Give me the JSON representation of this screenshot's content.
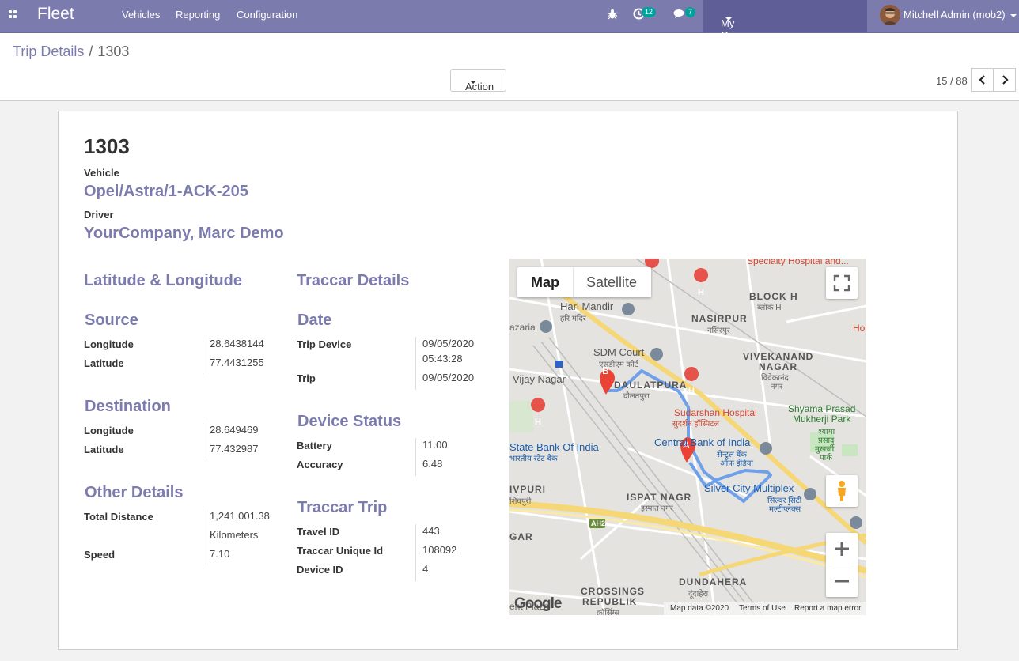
{
  "navbar": {
    "app_name": "Fleet",
    "menus": [
      "Vehicles",
      "Reporting",
      "Configuration"
    ],
    "activity_count": "12",
    "message_count": "7",
    "company": "My Company (San Francisco)",
    "user": "Mitchell Admin (mob2)",
    "color": "#7c7bad"
  },
  "control": {
    "breadcrumb_parent": "Trip Details",
    "breadcrumb_sep": "/",
    "breadcrumb_current": "1303",
    "action_label": "Action",
    "pager": "15 / 88"
  },
  "record": {
    "title": "1303",
    "vehicle_label": "Vehicle",
    "vehicle": "Opel/Astra/1-ACK-205",
    "driver_label": "Driver",
    "driver": "YourCompany, Marc Demo"
  },
  "left": {
    "heading": "Latitude & Longitude",
    "source": {
      "title": "Source",
      "longitude_label": "Longitude",
      "longitude": "28.6438144",
      "latitude_label": "Latitude",
      "latitude": "77.4431255"
    },
    "destination": {
      "title": "Destination",
      "longitude_label": "Longitude",
      "longitude": "28.649469",
      "latitude_label": "Latitude",
      "latitude": "77.432987"
    },
    "other": {
      "title": "Other Details",
      "total_distance_label": "Total Distance",
      "total_distance": "1,241,001.38",
      "total_distance_unit": "Kilometers",
      "speed_label": "Speed",
      "speed": "7.10"
    }
  },
  "right": {
    "heading": "Traccar Details",
    "date": {
      "title": "Date",
      "trip_device_label": "Trip Device",
      "trip_device_date": "09/05/2020",
      "trip_device_time": "05:43:28",
      "trip_label": "Trip",
      "trip": "09/05/2020"
    },
    "device_status": {
      "title": "Device Status",
      "battery_label": "Battery",
      "battery": "11.00",
      "accuracy_label": "Accuracy",
      "accuracy": "6.48"
    },
    "traccar_trip": {
      "title": "Traccar Trip",
      "travel_id_label": "Travel ID",
      "travel_id": "443",
      "unique_id_label": "Traccar Unique Id",
      "unique_id": "108092",
      "device_id_label": "Device ID",
      "device_id": "4"
    }
  },
  "map": {
    "tab_map": "Map",
    "tab_satellite": "Satellite",
    "marker_a": "A",
    "marker_b": "B",
    "labels": {
      "hari_mandir": "Hari Mandir",
      "hari_mandir_hi": "हरि मंदिर",
      "nasirpur": "NASIRPUR",
      "nasirpur_hi": "नसिरपुर",
      "block_h": "BLOCK H",
      "block_h_hi": "ब्लॉक H",
      "sdm_court": "SDM Court",
      "sdm_court_hi": "एसडीएम कोर्ट",
      "vivekanand": "VIVEKANAND",
      "vivekanand2": "NAGAR",
      "vivekanand_hi": "विवेकानंद",
      "vivekanand_hi2": "नगर",
      "daulatpura": "DAULATPURA",
      "daulatpura_hi": "दौलतपुरा",
      "vijay_nagar": "Vijay Nagar",
      "sudarshan": "Sudarshan Hospital",
      "sudarshan_hi": "सुदर्शन हॉस्पिटल",
      "shyama": "Shyama Prasad",
      "shyama2": "Mukherji Park",
      "shyama_hi": "श्यामा",
      "shyama_hi2": "प्रसाद",
      "shyama_hi3": "मुखर्जी",
      "shyama_hi4": "पार्क",
      "sbi": "State Bank Of India",
      "sbi_hi": "भारतीय स्टेट बैंक",
      "cboi": "Central Bank of India",
      "cboi_hi": "सेन्ट्रल बैंक",
      "cboi_hi2": "ऑफ इंडिया",
      "silver_city": "Silver City Multiplex",
      "silver_city_hi": "सिल्वर सिटी",
      "silver_city_hi2": "मल्टीप्लेक्स",
      "ivpuri": "IVPURI",
      "ivpuri_hi": "शिवपुरी",
      "ispat": "ISPAT NAGR",
      "ispat_hi": "इस्पात नगर",
      "ah2": "AH2",
      "gar": "GAR",
      "dundahera": "DUNDAHERA",
      "dundahera_hi": "दूंदाहेरा",
      "crossings": "CROSSINGS",
      "crossings2": "REPUBLIK",
      "crossings_hi": "क्रॉसिंग्स",
      "specialty": "Specialty Hospital and...",
      "hos": "Hos",
      "azaria": "azaria",
      "ent_plaza": "ent Plaza"
    },
    "google": "Google",
    "map_data": "Map data ©2020",
    "terms": "Terms of Use",
    "report": "Report a map error"
  }
}
